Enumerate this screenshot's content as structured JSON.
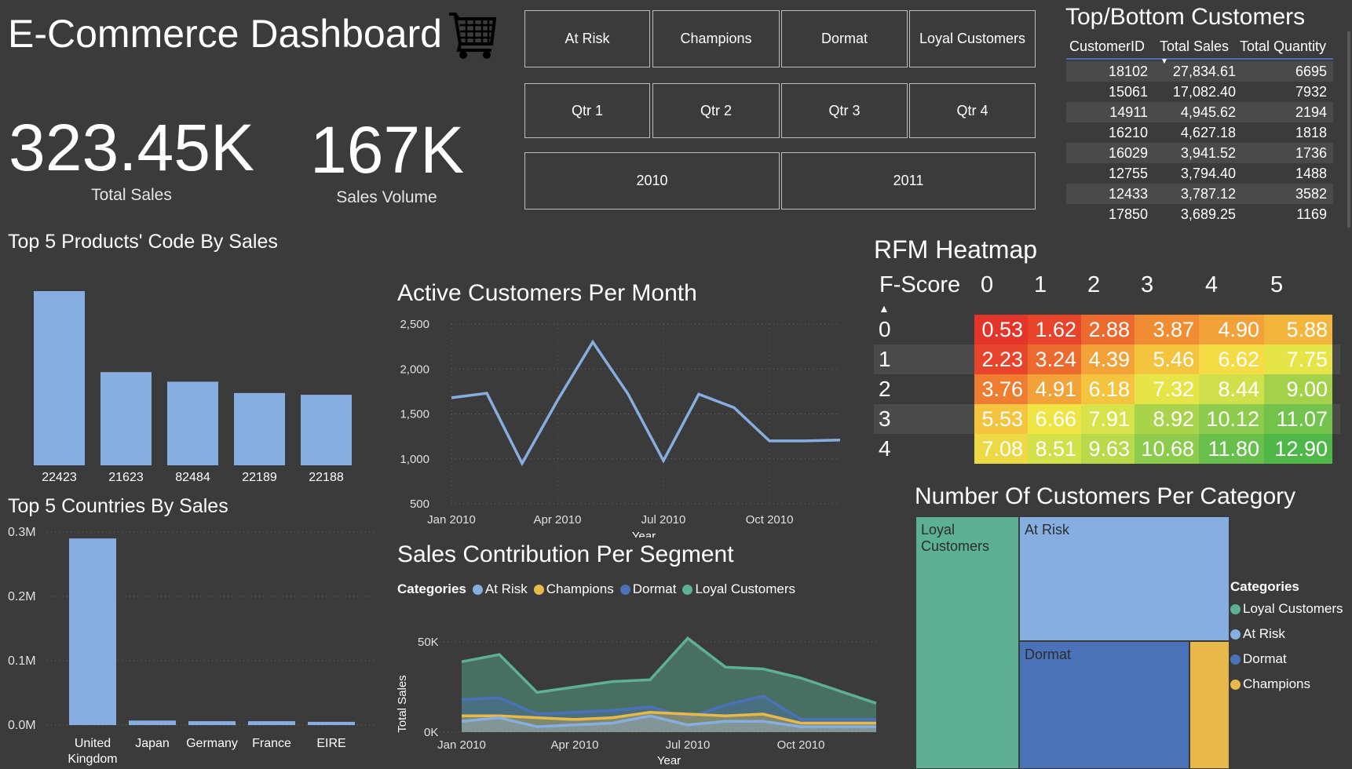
{
  "header": {
    "title": "E-Commerce Dashboard",
    "cart_icon": "shopping-cart-icon"
  },
  "kpis": [
    {
      "value": "323.45K",
      "label": "Total Sales"
    },
    {
      "value": "167K",
      "label": "Sales Volume"
    }
  ],
  "slicers": {
    "segments": [
      "At Risk",
      "Champions",
      "Dormat",
      "Loyal Customers"
    ],
    "quarters": [
      "Qtr 1",
      "Qtr 2",
      "Qtr 3",
      "Qtr 4"
    ],
    "years": [
      "2010",
      "2011"
    ]
  },
  "top_bottom": {
    "title": "Top/Bottom Customers",
    "headers": [
      "CustomerID",
      "Total Sales",
      "Total Quantity"
    ],
    "sort_icon": "sort-descending-icon",
    "rows": [
      [
        "18102",
        "27,834.61",
        "6695"
      ],
      [
        "15061",
        "17,082.40",
        "7932"
      ],
      [
        "14911",
        "4,945.62",
        "2194"
      ],
      [
        "16210",
        "4,627.18",
        "1818"
      ],
      [
        "16029",
        "3,941.52",
        "1736"
      ],
      [
        "12755",
        "3,794.40",
        "1488"
      ],
      [
        "12433",
        "3,787.12",
        "3582"
      ],
      [
        "17850",
        "3,689.25",
        "1169"
      ]
    ]
  },
  "colors": {
    "background": "#3b3b3b",
    "bar": "#86aee0",
    "at_risk": "#86aee0",
    "champions": "#e8b84a",
    "dormat": "#4a72b8",
    "loyal": "#5cb094"
  },
  "chart_data": [
    {
      "type": "bar",
      "title": "Top 5 Products' Code By Sales",
      "categories": [
        "22423",
        "21623",
        "82484",
        "22189",
        "22188"
      ],
      "values": [
        100,
        53.5,
        48,
        41.5,
        40.5
      ]
    },
    {
      "type": "bar",
      "title": "Top 5 Countries By Sales",
      "categories": [
        "United Kingdom",
        "Japan",
        "Germany",
        "France",
        "EIRE"
      ],
      "values": [
        0.29,
        0.007,
        0.006,
        0.006,
        0.005
      ],
      "yticks": [
        "0.0M",
        "0.1M",
        "0.2M",
        "0.3M"
      ],
      "ylim": [
        0,
        0.3
      ]
    },
    {
      "type": "line",
      "title": "Active Customers Per Month",
      "xlabel": "Year",
      "xticks": [
        "Jan 2010",
        "Apr 2010",
        "Jul 2010",
        "Oct 2010"
      ],
      "yticks": [
        "500",
        "1,000",
        "1,500",
        "2,000",
        "2,500"
      ],
      "ylim": [
        500,
        2500
      ],
      "x": [
        "Jan 2010",
        "Feb 2010",
        "Mar 2010",
        "Apr 2010",
        "May 2010",
        "Jun 2010",
        "Jul 2010",
        "Aug 2010",
        "Sep 2010",
        "Oct 2010",
        "Nov 2010",
        "Dec 2010"
      ],
      "values": [
        1680,
        1730,
        950,
        1650,
        2300,
        1720,
        980,
        1720,
        1570,
        1200,
        1200,
        1210
      ]
    },
    {
      "type": "area",
      "title": "Sales Contribution Per Segment",
      "legend_title": "Categories",
      "xlabel": "Year",
      "ylabel": "Total Sales",
      "xticks": [
        "Jan 2010",
        "Apr 2010",
        "Jul 2010",
        "Oct 2010"
      ],
      "yticks": [
        "0K",
        "50K"
      ],
      "ylim": [
        0,
        60000
      ],
      "x": [
        "Jan 2010",
        "Feb 2010",
        "Mar 2010",
        "Apr 2010",
        "May 2010",
        "Jun 2010",
        "Jul 2010",
        "Aug 2010",
        "Sep 2010",
        "Oct 2010",
        "Nov 2010",
        "Dec 2010"
      ],
      "series": [
        {
          "name": "At Risk",
          "values": [
            6000,
            8000,
            3000,
            4000,
            5000,
            9000,
            4000,
            6000,
            6000,
            3000,
            3000,
            3000
          ]
        },
        {
          "name": "Champions",
          "values": [
            9000,
            9000,
            8000,
            7000,
            8000,
            11000,
            10000,
            9000,
            10000,
            5000,
            5000,
            5000
          ]
        },
        {
          "name": "Dormat",
          "values": [
            18000,
            19000,
            10000,
            11000,
            12000,
            14000,
            8000,
            15000,
            20000,
            7000,
            7000,
            7000
          ]
        },
        {
          "name": "Loyal Customers",
          "values": [
            39000,
            43000,
            22000,
            25000,
            28000,
            29000,
            52000,
            36000,
            35000,
            30000,
            23000,
            16000
          ]
        }
      ]
    },
    {
      "type": "heatmap",
      "title": "RFM Heatmap",
      "row_header": "F-Score",
      "columns": [
        "0",
        "1",
        "2",
        "3",
        "4",
        "5"
      ],
      "rows": [
        "0",
        "1",
        "2",
        "3",
        "4"
      ],
      "values": [
        [
          "0.53",
          "1.62",
          "2.88",
          "3.87",
          "4.90",
          "5.88"
        ],
        [
          "2.23",
          "3.24",
          "4.39",
          "5.46",
          "6.62",
          "7.75"
        ],
        [
          "3.76",
          "4.91",
          "6.18",
          "7.32",
          "8.44",
          "9.00"
        ],
        [
          "5.53",
          "6.66",
          "7.91",
          "8.92",
          "10.12",
          "11.07"
        ],
        [
          "7.08",
          "8.51",
          "9.63",
          "10.68",
          "11.80",
          "12.90"
        ]
      ],
      "colors": [
        [
          "#e4352b",
          "#e8432b",
          "#ec6a2e",
          "#f08d33",
          "#f2a238",
          "#f4b53c"
        ],
        [
          "#e8432b",
          "#ec6a2e",
          "#f2a238",
          "#f4c43e",
          "#f5dc45",
          "#e6e446"
        ],
        [
          "#ee7d31",
          "#f2a238",
          "#f4c43e",
          "#e6e446",
          "#cfe04a",
          "#a3d14a"
        ],
        [
          "#f4c43e",
          "#eee545",
          "#d8e24a",
          "#a9d34a",
          "#8ccb4b",
          "#72c24b"
        ],
        [
          "#ecd945",
          "#d2e04a",
          "#b8d94a",
          "#8ccb4b",
          "#68bf4b",
          "#4fb648"
        ]
      ],
      "sort_icon": "sort-ascending-icon"
    },
    {
      "type": "treemap",
      "title": "Number Of Customers Per Category",
      "legend_title": "Categories",
      "categories": [
        "Loyal Customers",
        "At Risk",
        "Dormat",
        "Champions"
      ],
      "values": [
        169,
        169,
        140,
        33
      ]
    }
  ]
}
